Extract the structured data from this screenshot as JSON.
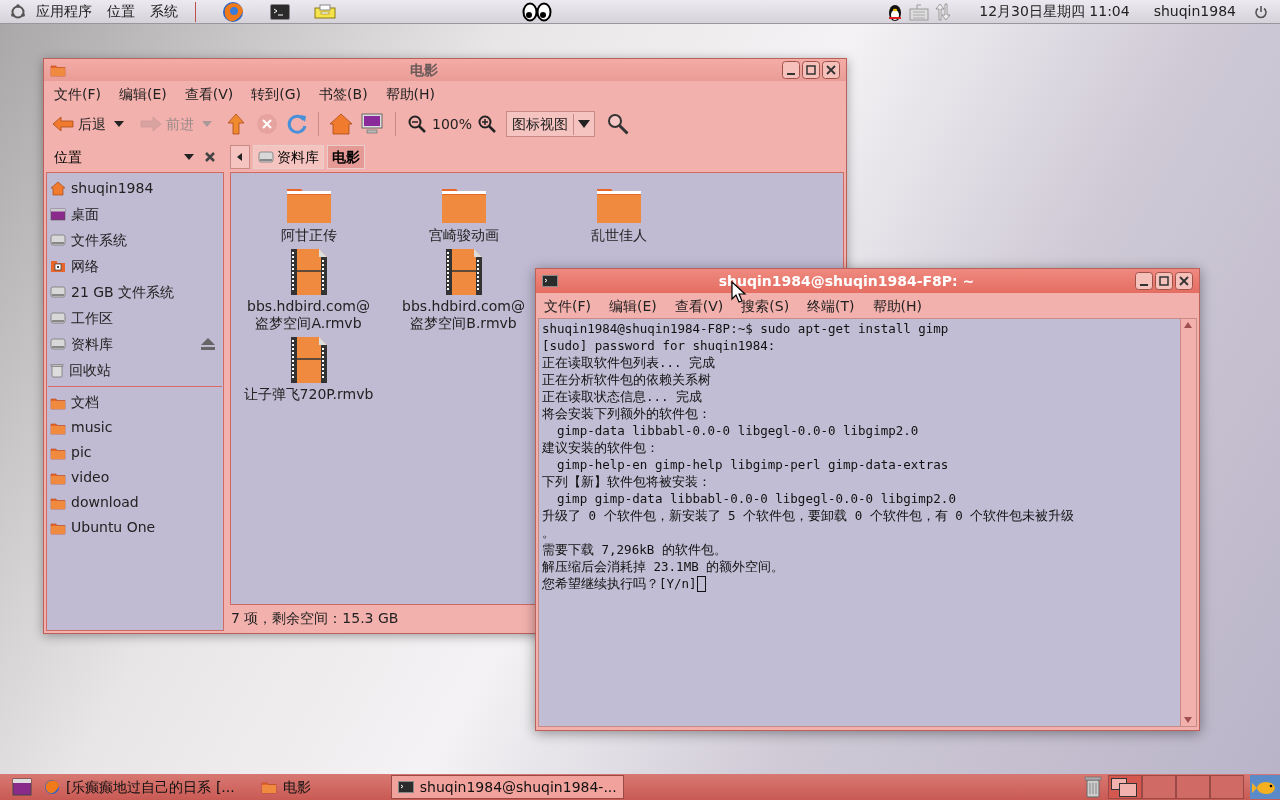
{
  "top_panel": {
    "menus": [
      "应用程序",
      "位置",
      "系统"
    ],
    "clock": "12月30日星期四 11:04",
    "user": "shuqin1984"
  },
  "file_manager": {
    "title": "电影",
    "menu": [
      "文件(F)",
      "编辑(E)",
      "查看(V)",
      "转到(G)",
      "书签(B)",
      "帮助(H)"
    ],
    "toolbar": {
      "back": {
        "label": "后退",
        "disabled": false
      },
      "forward": {
        "label": "前进",
        "disabled": true
      },
      "zoom": "100%",
      "view": "图标视图"
    },
    "sidebar_title": "位置",
    "breadcrumbs": [
      {
        "label": "资料库",
        "selected": false
      },
      {
        "label": "电影",
        "selected": true
      }
    ],
    "places": [
      {
        "label": "shuqin1984",
        "kind": "home",
        "ejectable": false
      },
      {
        "label": "桌面",
        "kind": "desktop",
        "ejectable": false
      },
      {
        "label": "文件系统",
        "kind": "drive",
        "ejectable": false
      },
      {
        "label": "网络",
        "kind": "network",
        "ejectable": false
      },
      {
        "label": "21 GB 文件系统",
        "kind": "drive",
        "ejectable": false
      },
      {
        "label": "工作区",
        "kind": "drive",
        "ejectable": false
      },
      {
        "label": "资料库",
        "kind": "drive",
        "ejectable": true
      },
      {
        "label": "回收站",
        "kind": "trash",
        "ejectable": false
      }
    ],
    "bookmarks": [
      {
        "label": "文档",
        "kind": "folder"
      },
      {
        "label": "music",
        "kind": "folder"
      },
      {
        "label": "pic",
        "kind": "folder"
      },
      {
        "label": "video",
        "kind": "folder"
      },
      {
        "label": "download",
        "kind": "folder"
      },
      {
        "label": "Ubuntu One",
        "kind": "folder"
      }
    ],
    "files": [
      {
        "name": "阿甘正传",
        "kind": "folder"
      },
      {
        "name": "宫崎骏动画",
        "kind": "folder"
      },
      {
        "name": "乱世佳人",
        "kind": "folder"
      },
      {
        "name": "bbs.hdbird.com@\n盗梦空间A.rmvb",
        "kind": "video"
      },
      {
        "name": "bbs.hdbird.com@\n盗梦空间B.rmvb",
        "kind": "video"
      },
      {
        "name": "让子弹飞720P.rmvb",
        "kind": "video"
      }
    ],
    "status": "7 项，剩余空间：15.3 GB"
  },
  "terminal": {
    "title": "shuqin1984@shuqin1984-F8P: ~",
    "menu": [
      "文件(F)",
      "编辑(E)",
      "查看(V)",
      "搜索(S)",
      "终端(T)",
      "帮助(H)"
    ],
    "lines": [
      "shuqin1984@shuqin1984-F8P:~$ sudo apt-get install gimp",
      "[sudo] password for shuqin1984:",
      "正在读取软件包列表... 完成",
      "正在分析软件包的依赖关系树",
      "正在读取状态信息... 完成",
      "将会安装下列额外的软件包：",
      "  gimp-data libbabl-0.0-0 libgegl-0.0-0 libgimp2.0",
      "建议安装的软件包：",
      "  gimp-help-en gimp-help libgimp-perl gimp-data-extras",
      "下列【新】软件包将被安装：",
      "  gimp gimp-data libbabl-0.0-0 libgegl-0.0-0 libgimp2.0",
      "升级了 0 个软件包，新安装了 5 个软件包，要卸载 0 个软件包，有 0 个软件包未被升级",
      "。",
      "需要下载 7,296kB 的软件包。",
      "解压缩后会消耗掉 23.1MB 的额外空间。",
      "您希望继续执行吗？[Y/n]"
    ]
  },
  "taskbar": {
    "items": [
      {
        "label": "[乐癫癫地过自己的日系 [...",
        "kind": "browser",
        "selected": false
      },
      {
        "label": "电影",
        "kind": "folder",
        "selected": false
      },
      {
        "label": "shuqin1984@shuqin1984-...",
        "kind": "terminal",
        "selected": true
      }
    ],
    "workspaces": [
      {
        "selected": true
      },
      {
        "selected": false
      },
      {
        "selected": false
      },
      {
        "selected": false
      }
    ]
  }
}
